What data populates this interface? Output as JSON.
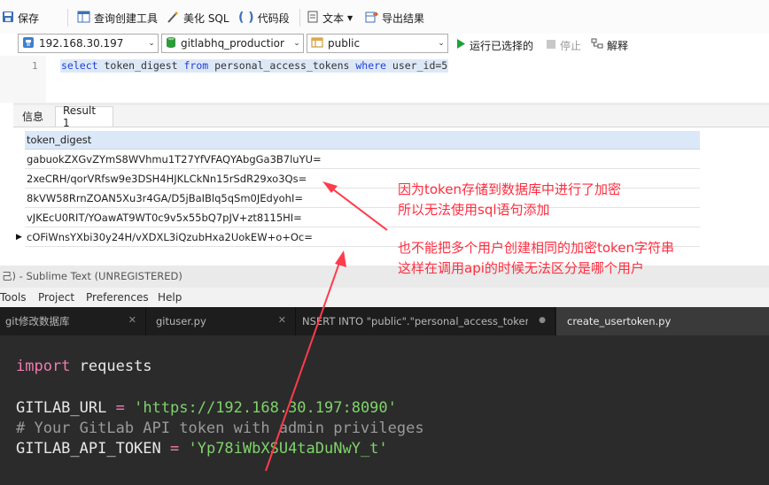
{
  "toolbar": {
    "save": "保存",
    "query_builder": "查询创建工具",
    "beautify": "美化 SQL",
    "snippet": "代码段",
    "text": "文本",
    "export": "导出结果"
  },
  "selectors": {
    "connection": "192.168.30.197",
    "database": "gitlabhq_productior",
    "schema": "public"
  },
  "run": {
    "run_selected": "运行已选择的",
    "stop": "停止",
    "explain": "解释"
  },
  "editor": {
    "line_number": "1",
    "sql_kw1": "select",
    "sql_t1": " token_digest ",
    "sql_kw2": "from",
    "sql_t2": " personal_access_tokens ",
    "sql_kw3": "where",
    "sql_t3": " user_id=5"
  },
  "result_tabs": [
    "信息",
    "Result 1"
  ],
  "grid": {
    "column": "token_digest",
    "rows": [
      "gabuokZXGvZYmS8WVhmu1T27YfVFAQYAbgGa3B7luYU=",
      "2xeCRH/qorVRfsw9e3DSH4HJKLCkNn15rSdR29xo3Qs=",
      "8kVW58RrnZOAN5Xu3r4GA/D5jBaIBlq5qSm0JEdyohI=",
      "vJKEcU0RIT/YOawAT9WT0c9v5x55bQ7pJV+zt8115HI=",
      "cOFiWnsYXbi30y24H/vXDXL3iQzubHxa2UokEW+o+Oc="
    ]
  },
  "annotations": {
    "note1_line1": "因为token存储到数据库中进行了加密",
    "note1_line2": "所以无法使用sql语句添加",
    "note2_line1": "也不能把多个用户创建相同的加密token字符串",
    "note2_line2": "这样在调用api的时候无法区分是哪个用户"
  },
  "sublime": {
    "title": "己) - Sublime Text (UNREGISTERED)",
    "menu": [
      "Tools",
      "Project",
      "Preferences",
      "Help"
    ],
    "tabs": [
      {
        "label": "git修改数据库"
      },
      {
        "label": "gituser.py"
      },
      {
        "label": "NSERT INTO \"public\".\"personal_access_tokens\"(\"id\""
      },
      {
        "label": "create_usertoken.py"
      }
    ],
    "code": {
      "import_kw": "import",
      "import_mod": " requests",
      "url_name": "GITLAB_URL ",
      "eq": "=",
      "url_val": " 'https://192.168.30.197:8090'",
      "comment": "# Your GitLab API token with admin privileges",
      "token_name": "GITLAB_API_TOKEN ",
      "token_val": " 'Yp78iWbXSU4taDuNwY_t'"
    }
  },
  "colors": {
    "annotation": "#ff2e40",
    "sql_keyword": "#1f3fd8",
    "run_green": "#1aa33a",
    "grid_header": "#dbe8f7",
    "sublime_bg": "#2b2b2b"
  }
}
